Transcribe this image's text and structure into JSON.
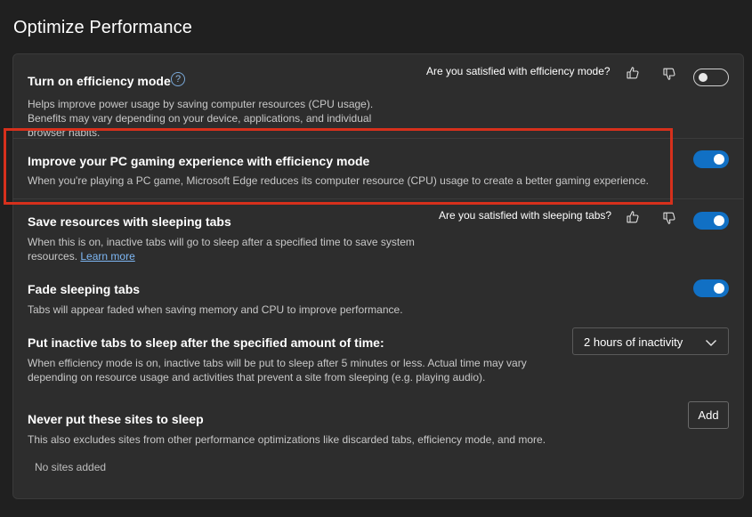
{
  "page": {
    "title": "Optimize Performance"
  },
  "efficiency_mode": {
    "title": "Turn on efficiency mode",
    "help_icon": "?",
    "description": "Helps improve power usage by saving computer resources (CPU usage). Benefits may vary depending on your device, applications, and individual browser habits.",
    "feedback_question": "Are you satisfied with efficiency mode?",
    "enabled": false
  },
  "gaming": {
    "title": "Improve your PC gaming experience with efficiency mode",
    "description": "When you're playing a PC game, Microsoft Edge reduces its computer resource (CPU) usage to create a better gaming experience.",
    "enabled": true
  },
  "sleeping_tabs": {
    "title": "Save resources with sleeping tabs",
    "description": "When this is on, inactive tabs will go to sleep after a specified time to save system resources.",
    "learn_more": "Learn more",
    "feedback_question": "Are you satisfied with sleeping tabs?",
    "enabled": true
  },
  "fade_tabs": {
    "title": "Fade sleeping tabs",
    "description": "Tabs will appear faded when saving memory and CPU to improve performance.",
    "enabled": true
  },
  "sleep_timer": {
    "title": "Put inactive tabs to sleep after the specified amount of time:",
    "description": "When efficiency mode is on, inactive tabs will be put to sleep after 5 minutes or less. Actual time may vary depending on resource usage and activities that prevent a site from sleeping (e.g. playing audio).",
    "selected": "2 hours of inactivity"
  },
  "never_sleep": {
    "title": "Never put these sites to sleep",
    "description": "This also excludes sites from other performance optimizations like discarded tabs, efficiency mode, and more.",
    "add_label": "Add",
    "empty_text": "No sites added"
  },
  "icons": {
    "thumbs_up": "thumbs-up-icon",
    "thumbs_down": "thumbs-down-icon",
    "help": "help-icon",
    "chevron": "chevron-down-icon"
  },
  "colors": {
    "background": "#202020",
    "card": "#2d2d2d",
    "toggle_on": "#1170c4",
    "link": "#7eb8f5",
    "highlight": "#d6301c"
  }
}
